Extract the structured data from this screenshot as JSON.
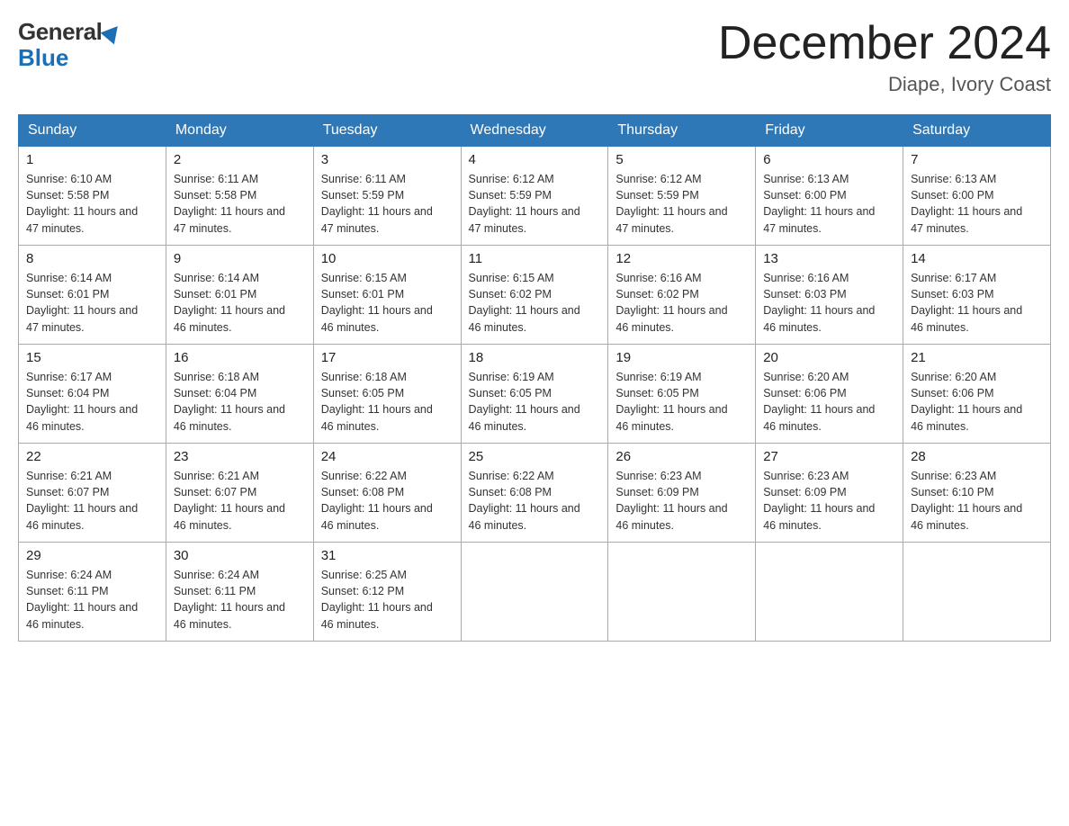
{
  "header": {
    "logo_general": "General",
    "logo_blue": "Blue",
    "month_title": "December 2024",
    "location": "Diape, Ivory Coast"
  },
  "days_of_week": [
    "Sunday",
    "Monday",
    "Tuesday",
    "Wednesday",
    "Thursday",
    "Friday",
    "Saturday"
  ],
  "weeks": [
    [
      {
        "num": "1",
        "sunrise": "6:10 AM",
        "sunset": "5:58 PM",
        "daylight": "11 hours and 47 minutes."
      },
      {
        "num": "2",
        "sunrise": "6:11 AM",
        "sunset": "5:58 PM",
        "daylight": "11 hours and 47 minutes."
      },
      {
        "num": "3",
        "sunrise": "6:11 AM",
        "sunset": "5:59 PM",
        "daylight": "11 hours and 47 minutes."
      },
      {
        "num": "4",
        "sunrise": "6:12 AM",
        "sunset": "5:59 PM",
        "daylight": "11 hours and 47 minutes."
      },
      {
        "num": "5",
        "sunrise": "6:12 AM",
        "sunset": "5:59 PM",
        "daylight": "11 hours and 47 minutes."
      },
      {
        "num": "6",
        "sunrise": "6:13 AM",
        "sunset": "6:00 PM",
        "daylight": "11 hours and 47 minutes."
      },
      {
        "num": "7",
        "sunrise": "6:13 AM",
        "sunset": "6:00 PM",
        "daylight": "11 hours and 47 minutes."
      }
    ],
    [
      {
        "num": "8",
        "sunrise": "6:14 AM",
        "sunset": "6:01 PM",
        "daylight": "11 hours and 47 minutes."
      },
      {
        "num": "9",
        "sunrise": "6:14 AM",
        "sunset": "6:01 PM",
        "daylight": "11 hours and 46 minutes."
      },
      {
        "num": "10",
        "sunrise": "6:15 AM",
        "sunset": "6:01 PM",
        "daylight": "11 hours and 46 minutes."
      },
      {
        "num": "11",
        "sunrise": "6:15 AM",
        "sunset": "6:02 PM",
        "daylight": "11 hours and 46 minutes."
      },
      {
        "num": "12",
        "sunrise": "6:16 AM",
        "sunset": "6:02 PM",
        "daylight": "11 hours and 46 minutes."
      },
      {
        "num": "13",
        "sunrise": "6:16 AM",
        "sunset": "6:03 PM",
        "daylight": "11 hours and 46 minutes."
      },
      {
        "num": "14",
        "sunrise": "6:17 AM",
        "sunset": "6:03 PM",
        "daylight": "11 hours and 46 minutes."
      }
    ],
    [
      {
        "num": "15",
        "sunrise": "6:17 AM",
        "sunset": "6:04 PM",
        "daylight": "11 hours and 46 minutes."
      },
      {
        "num": "16",
        "sunrise": "6:18 AM",
        "sunset": "6:04 PM",
        "daylight": "11 hours and 46 minutes."
      },
      {
        "num": "17",
        "sunrise": "6:18 AM",
        "sunset": "6:05 PM",
        "daylight": "11 hours and 46 minutes."
      },
      {
        "num": "18",
        "sunrise": "6:19 AM",
        "sunset": "6:05 PM",
        "daylight": "11 hours and 46 minutes."
      },
      {
        "num": "19",
        "sunrise": "6:19 AM",
        "sunset": "6:05 PM",
        "daylight": "11 hours and 46 minutes."
      },
      {
        "num": "20",
        "sunrise": "6:20 AM",
        "sunset": "6:06 PM",
        "daylight": "11 hours and 46 minutes."
      },
      {
        "num": "21",
        "sunrise": "6:20 AM",
        "sunset": "6:06 PM",
        "daylight": "11 hours and 46 minutes."
      }
    ],
    [
      {
        "num": "22",
        "sunrise": "6:21 AM",
        "sunset": "6:07 PM",
        "daylight": "11 hours and 46 minutes."
      },
      {
        "num": "23",
        "sunrise": "6:21 AM",
        "sunset": "6:07 PM",
        "daylight": "11 hours and 46 minutes."
      },
      {
        "num": "24",
        "sunrise": "6:22 AM",
        "sunset": "6:08 PM",
        "daylight": "11 hours and 46 minutes."
      },
      {
        "num": "25",
        "sunrise": "6:22 AM",
        "sunset": "6:08 PM",
        "daylight": "11 hours and 46 minutes."
      },
      {
        "num": "26",
        "sunrise": "6:23 AM",
        "sunset": "6:09 PM",
        "daylight": "11 hours and 46 minutes."
      },
      {
        "num": "27",
        "sunrise": "6:23 AM",
        "sunset": "6:09 PM",
        "daylight": "11 hours and 46 minutes."
      },
      {
        "num": "28",
        "sunrise": "6:23 AM",
        "sunset": "6:10 PM",
        "daylight": "11 hours and 46 minutes."
      }
    ],
    [
      {
        "num": "29",
        "sunrise": "6:24 AM",
        "sunset": "6:11 PM",
        "daylight": "11 hours and 46 minutes."
      },
      {
        "num": "30",
        "sunrise": "6:24 AM",
        "sunset": "6:11 PM",
        "daylight": "11 hours and 46 minutes."
      },
      {
        "num": "31",
        "sunrise": "6:25 AM",
        "sunset": "6:12 PM",
        "daylight": "11 hours and 46 minutes."
      },
      null,
      null,
      null,
      null
    ]
  ]
}
